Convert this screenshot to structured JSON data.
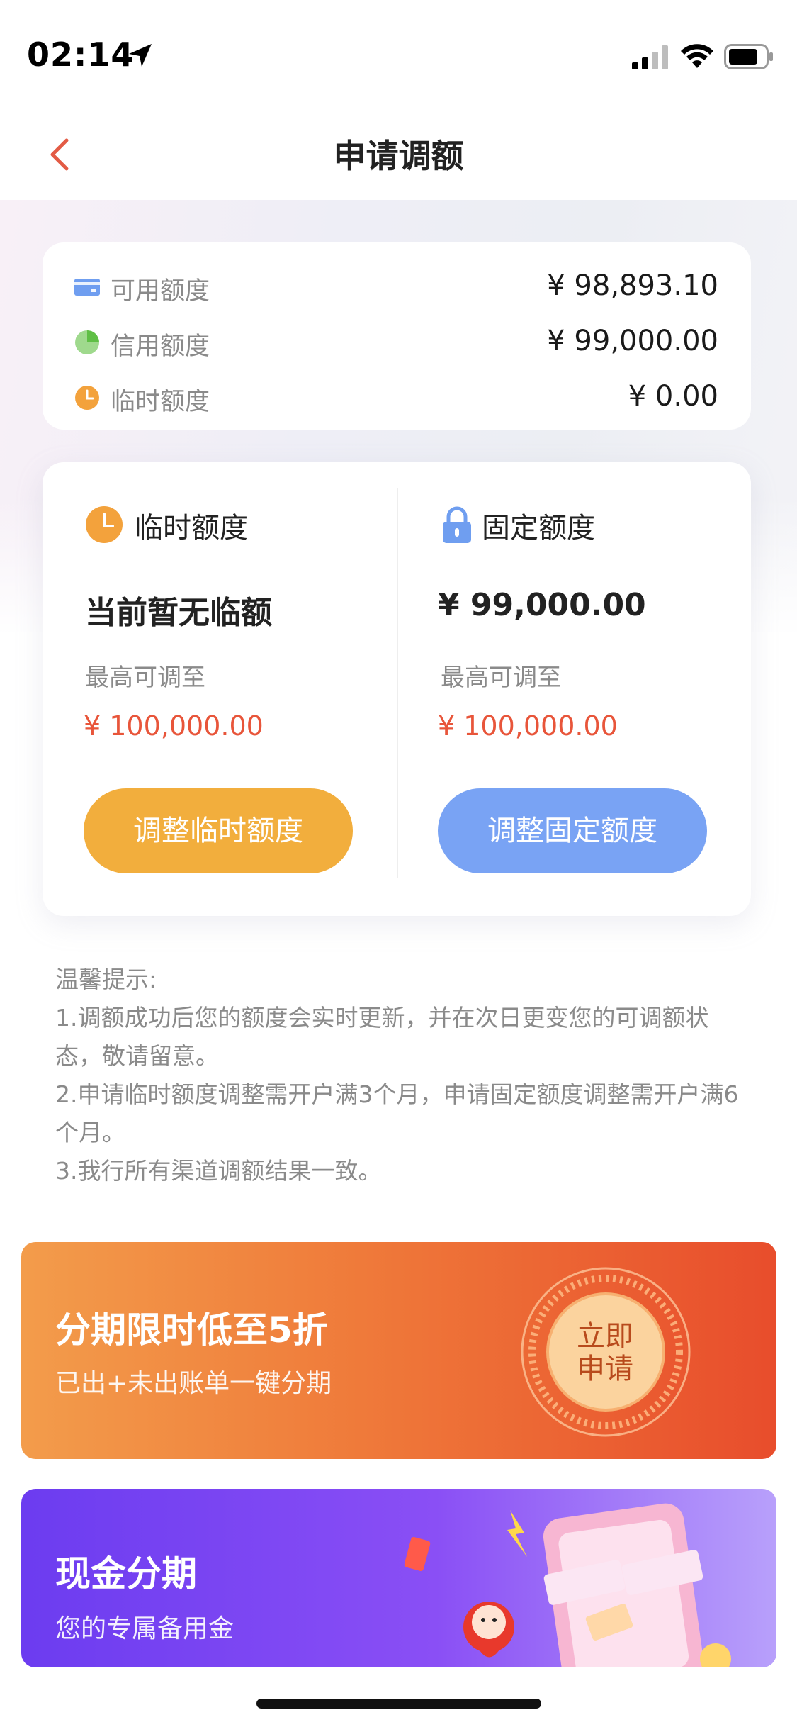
{
  "status_bar": {
    "time": "02:14"
  },
  "nav": {
    "title": "申请调额"
  },
  "summary": {
    "rows": [
      {
        "label": "可用额度",
        "value": "¥ 98,893.10",
        "icon": "card-icon"
      },
      {
        "label": "信用额度",
        "value": "¥ 99,000.00",
        "icon": "pie-icon"
      },
      {
        "label": "临时额度",
        "value": "¥ 0.00",
        "icon": "clock-icon"
      }
    ]
  },
  "temporary": {
    "title": "临时额度",
    "status": "当前暂无临额",
    "max_label": "最高可调至",
    "max_value": "¥ 100,000.00",
    "button": "调整临时额度"
  },
  "fixed": {
    "title": "固定额度",
    "amount": "¥ 99,000.00",
    "max_label": "最高可调至",
    "max_value": "¥ 100,000.00",
    "button": "调整固定额度"
  },
  "tips": {
    "heading": "温馨提示:",
    "items": [
      "1.调额成功后您的额度会实时更新，并在次日更变您的可调额状态，敬请留意。",
      "2.申请临时额度调整需开户满3个月，申请固定额度调整需开户满6个月。",
      "3.我行所有渠道调额结果一致。"
    ]
  },
  "banners": {
    "installment": {
      "title": "分期限时低至5折",
      "subtitle": "已出+未出账单一键分期",
      "badge_line1": "立即",
      "badge_line2": "申请"
    },
    "cash": {
      "title": "现金分期",
      "subtitle": "您的专属备用金"
    }
  },
  "colors": {
    "accent_red": "#e8553a",
    "orange_button": "#f2ae3d",
    "blue_button": "#79a3f4"
  }
}
